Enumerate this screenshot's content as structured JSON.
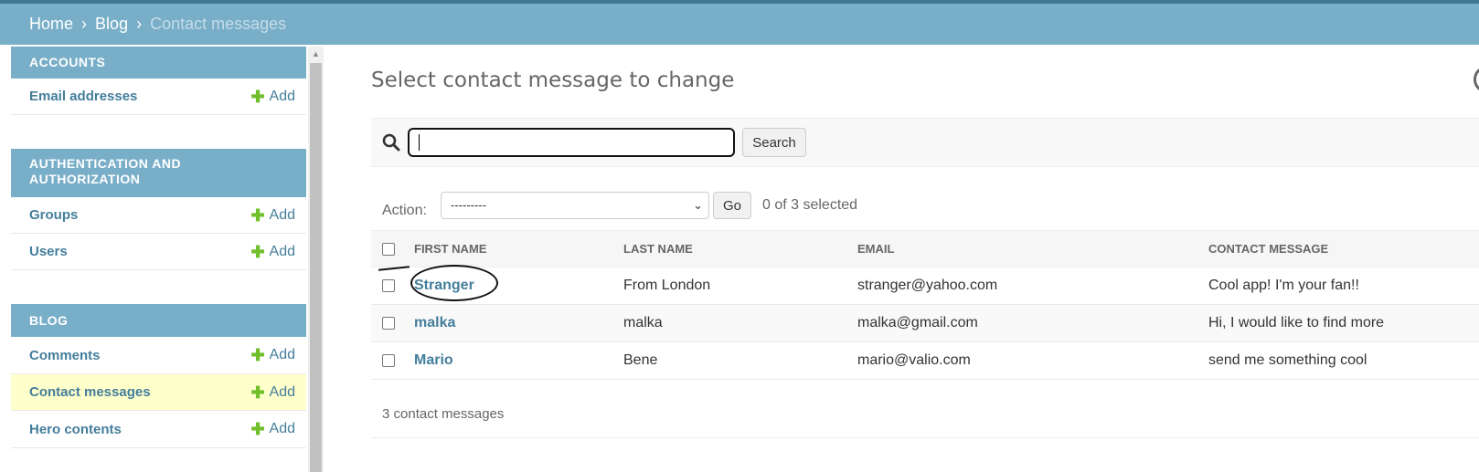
{
  "breadcrumbs": {
    "home": "Home",
    "sep": "›",
    "blog": "Blog",
    "current": "Contact messages"
  },
  "sidebar": {
    "modules": [
      {
        "caption": "ACCOUNTS",
        "rows": [
          {
            "model": "Email addresses",
            "add": "Add"
          }
        ]
      },
      {
        "caption": "AUTHENTICATION AND AUTHORIZATION",
        "rows": [
          {
            "model": "Groups",
            "add": "Add"
          },
          {
            "model": "Users",
            "add": "Add"
          }
        ]
      },
      {
        "caption": "BLOG",
        "rows": [
          {
            "model": "Comments",
            "add": "Add"
          },
          {
            "model": "Contact messages",
            "add": "Add"
          },
          {
            "model": "Hero contents",
            "add": "Add"
          }
        ]
      }
    ]
  },
  "main": {
    "title": "Select contact message to change",
    "search": {
      "value": "",
      "button": "Search"
    },
    "actions": {
      "label": "Action:",
      "selected": "---------",
      "go": "Go",
      "count": "0 of 3 selected"
    },
    "table": {
      "headers": [
        "FIRST NAME",
        "LAST NAME",
        "EMAIL",
        "CONTACT MESSAGE"
      ],
      "rows": [
        {
          "first": "Stranger",
          "last": "From London",
          "email": "stranger@yahoo.com",
          "message": "Cool app! I'm your fan!!"
        },
        {
          "first": "malka",
          "last": "malka",
          "email": "malka@gmail.com",
          "message": "Hi, I would like to find more"
        },
        {
          "first": "Mario",
          "last": "Bene",
          "email": "mario@valio.com",
          "message": "send me something cool"
        }
      ]
    },
    "paginator": "3 contact messages"
  },
  "colors": {
    "header": "#79aec8",
    "link": "#447e9b",
    "add_plus": "#70bf2b",
    "selected_row": "#ffffcc"
  }
}
